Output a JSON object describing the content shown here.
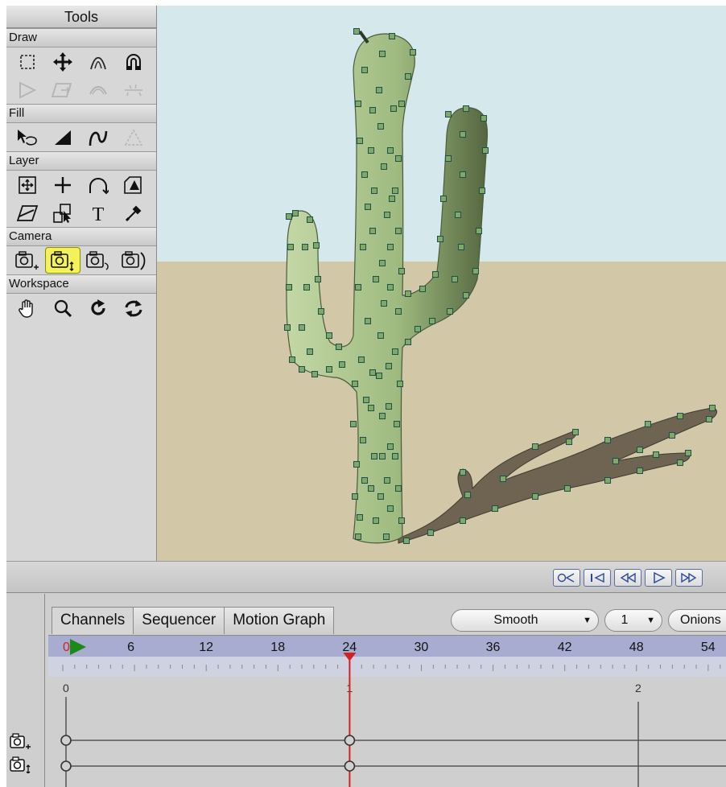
{
  "tools_panel": {
    "title": "Tools",
    "sections": {
      "draw": "Draw",
      "fill": "Fill",
      "layer": "Layer",
      "camera": "Camera",
      "workspace": "Workspace"
    },
    "icons": {
      "draw_row1": [
        "select-points-icon",
        "translate-points-icon",
        "curvature-icon",
        "magnet-icon"
      ],
      "draw_row2": [
        "add-point-icon",
        "transform-icon",
        "curve-icon",
        "scatter-icon"
      ],
      "fill_row": [
        "select-shape-icon",
        "create-shape-icon",
        "stroke-icon",
        "hide-edge-icon"
      ],
      "layer_row1": [
        "transform-layer-icon",
        "set-origin-icon",
        "rotate-layer-icon",
        "scale-layer-icon"
      ],
      "layer_row2": [
        "shear-layer-icon",
        "group-icon",
        "text-icon",
        "eyedropper-icon"
      ],
      "camera_row": [
        "track-camera-icon",
        "zoom-camera-icon",
        "roll-camera-icon",
        "pan-tilt-camera-icon"
      ],
      "workspace_row": [
        "hand-icon",
        "zoom-icon",
        "rotate-workspace-icon",
        "orbit-workspace-icon"
      ]
    },
    "active_tool": "zoom-camera-icon"
  },
  "transport": {
    "buttons": [
      "rewind-icon",
      "step-back-icon",
      "previous-keyframe-icon",
      "play-icon",
      "next-keyframe-icon"
    ]
  },
  "timeline": {
    "tabs": [
      "Channels",
      "Sequencer",
      "Motion Graph"
    ],
    "active_tab": "Channels",
    "interpolation": "Smooth",
    "frames_per_key": "1",
    "onion_label": "Onions",
    "ruler_ticks": [
      "0",
      "6",
      "12",
      "18",
      "24",
      "30",
      "36",
      "42",
      "48",
      "54"
    ],
    "current_frame": 24,
    "graph_labels": [
      "0",
      "1",
      "2"
    ],
    "channel_icons": [
      "track-camera-icon",
      "zoom-camera-icon"
    ]
  },
  "colors": {
    "sky": "#d5e9ec",
    "ground": "#d2c7a6",
    "cactus": "#9fbb80",
    "shadow": "#6f6351",
    "active_tool": "#f4f25a",
    "playhead": "#d42020",
    "ruler_bar": "#a8acd0"
  }
}
